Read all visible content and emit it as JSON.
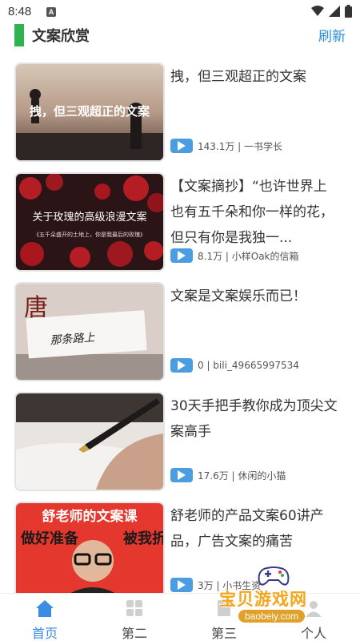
{
  "status_bar": {
    "time": "8:48",
    "notice_icon": "A"
  },
  "header": {
    "title": "文案欣赏",
    "refresh_label": "刷新"
  },
  "colors": {
    "accent_green": "#2fb24f",
    "accent_blue": "#2a8fd8",
    "badge_blue": "#4a9de0",
    "nav_active": "#3a8de0"
  },
  "items": [
    {
      "title": "拽，但三观超正的文案",
      "meta": "143.1万 | 一书学长",
      "thumb_caption": "拽，但三观超正的文案"
    },
    {
      "title": "【文案摘抄】“也许世界上也有五千朵和你一样的花，但只有你是我独一...",
      "meta": "8.1万 | 小样Oak的信箱",
      "thumb_caption": "关于玫瑰的高级浪漫文案",
      "thumb_subcaption": "《五千朵盛开的土地上，你是我最后的玫瑰》"
    },
    {
      "title": "文案是文案娱乐而已！",
      "meta": "0 | bili_49665997534",
      "thumb_caption": "那条路上"
    },
    {
      "title": "30天手把手教你成为顶尖文案高手",
      "meta": "17.6万 | 休闲的小猫"
    },
    {
      "title": "舒老师的产品文案60讲产品，广告文案的痛苦",
      "meta": "3万 | 小书生资",
      "thumb_caption": "舒老师的文案课",
      "thumb_left": "做好准备",
      "thumb_right": "被我折磨"
    }
  ],
  "bottom_nav": [
    {
      "label": "首页",
      "icon": "home-icon",
      "active": true
    },
    {
      "label": "第二",
      "icon": "grid-icon",
      "active": false
    },
    {
      "label": "第三",
      "icon": "document-icon",
      "active": false
    },
    {
      "label": "个人",
      "icon": "person-icon",
      "active": false
    }
  ],
  "watermark": {
    "text": "宝贝游戏网",
    "url": "baobeiy.com"
  }
}
